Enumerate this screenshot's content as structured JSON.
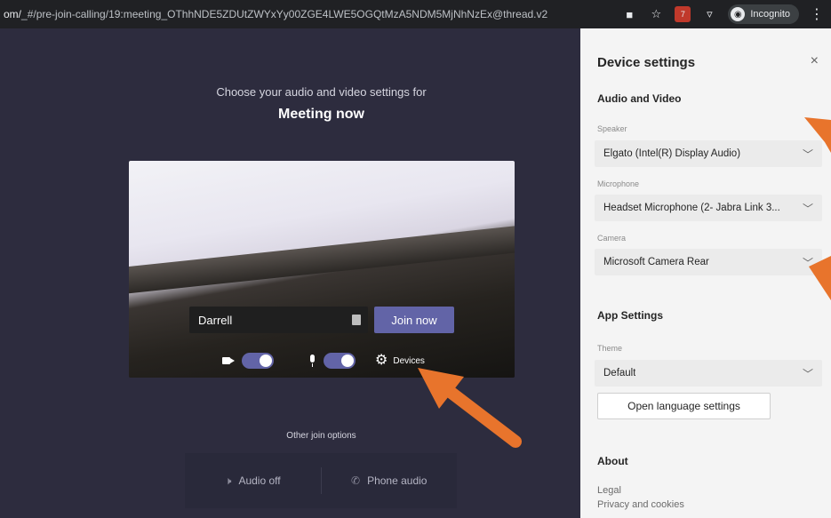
{
  "browser": {
    "url_host": "om/",
    "url_path": "_#/pre-join-calling/19:meeting_OThhNDE5ZDUtZWYxYy00ZGE4LWE5OGQtMzA5NDM5MjNhNzEx@thread.v2",
    "incognito_label": "Incognito",
    "extension_badge": "7"
  },
  "prejoin": {
    "subtitle": "Choose your audio and video settings for",
    "title": "Meeting now",
    "name_value": "Darrell",
    "join_label": "Join now",
    "devices_label": "Devices",
    "camera_on": true,
    "mic_on": true,
    "other_join_label": "Other join options",
    "options": [
      {
        "label": "Audio off",
        "icon": "speaker-off-icon"
      },
      {
        "label": "Phone audio",
        "icon": "phone-icon"
      }
    ]
  },
  "panel": {
    "title": "Device settings",
    "close_label": "×",
    "audio_video_heading": "Audio and Video",
    "speaker_label": "Speaker",
    "speaker_value": "Elgato (Intel(R) Display Audio)",
    "microphone_label": "Microphone",
    "microphone_value": "Headset Microphone (2- Jabra Link 3...",
    "camera_label": "Camera",
    "camera_value": "Microsoft Camera Rear",
    "app_settings_heading": "App Settings",
    "theme_label": "Theme",
    "theme_value": "Default",
    "language_button": "Open language settings",
    "about_heading": "About",
    "legal_link": "Legal",
    "privacy_link": "Privacy and cookies"
  },
  "colors": {
    "accent": "#6264a7",
    "annotation_arrow": "#e8742c"
  }
}
